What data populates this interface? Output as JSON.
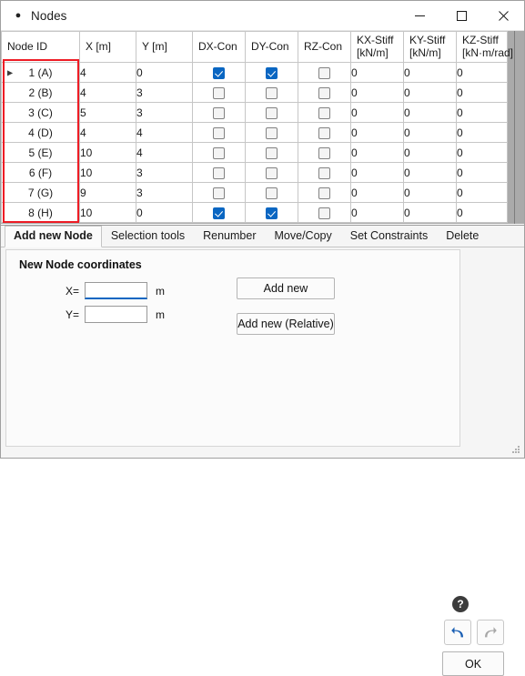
{
  "window": {
    "title": "Nodes",
    "icon": "dot-icon",
    "controls": {
      "minimize": "minimize-icon",
      "maximize": "maximize-icon",
      "close": "close-icon"
    }
  },
  "table": {
    "columns": [
      {
        "key": "node_id",
        "label": "Node ID",
        "unit": ""
      },
      {
        "key": "x",
        "label": "X [m]",
        "unit": ""
      },
      {
        "key": "y",
        "label": "Y [m]",
        "unit": ""
      },
      {
        "key": "dx_con",
        "label": "DX-Con",
        "unit": ""
      },
      {
        "key": "dy_con",
        "label": "DY-Con",
        "unit": ""
      },
      {
        "key": "rz_con",
        "label": "RZ-Con",
        "unit": ""
      },
      {
        "key": "kx_stiff",
        "label": "KX-Stiff",
        "unit": "[kN/m]"
      },
      {
        "key": "ky_stiff",
        "label": "KY-Stiff",
        "unit": "[kN/m]"
      },
      {
        "key": "kz_stiff",
        "label": "KZ-Stiff",
        "unit": "[kN·m/rad]"
      }
    ],
    "rows": [
      {
        "node_id": "1 (A)",
        "x": "4",
        "y": "0",
        "dx_con": true,
        "dy_con": true,
        "rz_con": false,
        "kx_stiff": "0",
        "ky_stiff": "0",
        "kz_stiff": "0",
        "selected": true,
        "current": true
      },
      {
        "node_id": "2 (B)",
        "x": "4",
        "y": "3",
        "dx_con": false,
        "dy_con": false,
        "rz_con": false,
        "kx_stiff": "0",
        "ky_stiff": "0",
        "kz_stiff": "0",
        "selected": false,
        "current": false
      },
      {
        "node_id": "3 (C)",
        "x": "5",
        "y": "3",
        "dx_con": false,
        "dy_con": false,
        "rz_con": false,
        "kx_stiff": "0",
        "ky_stiff": "0",
        "kz_stiff": "0",
        "selected": false,
        "current": false
      },
      {
        "node_id": "4 (D)",
        "x": "4",
        "y": "4",
        "dx_con": false,
        "dy_con": false,
        "rz_con": false,
        "kx_stiff": "0",
        "ky_stiff": "0",
        "kz_stiff": "0",
        "selected": false,
        "current": false
      },
      {
        "node_id": "5 (E)",
        "x": "10",
        "y": "4",
        "dx_con": false,
        "dy_con": false,
        "rz_con": false,
        "kx_stiff": "0",
        "ky_stiff": "0",
        "kz_stiff": "0",
        "selected": false,
        "current": false
      },
      {
        "node_id": "6 (F)",
        "x": "10",
        "y": "3",
        "dx_con": false,
        "dy_con": false,
        "rz_con": false,
        "kx_stiff": "0",
        "ky_stiff": "0",
        "kz_stiff": "0",
        "selected": false,
        "current": false
      },
      {
        "node_id": "7 (G)",
        "x": "9",
        "y": "3",
        "dx_con": false,
        "dy_con": false,
        "rz_con": false,
        "kx_stiff": "0",
        "ky_stiff": "0",
        "kz_stiff": "0",
        "selected": false,
        "current": false
      },
      {
        "node_id": "8 (H)",
        "x": "10",
        "y": "0",
        "dx_con": true,
        "dy_con": true,
        "rz_con": false,
        "kx_stiff": "0",
        "ky_stiff": "0",
        "kz_stiff": "0",
        "selected": false,
        "current": false
      }
    ],
    "row_marker_icon": "triangle-right-icon",
    "highlight": {
      "color": "#ee1c25",
      "target": "node-id-column"
    }
  },
  "tabs": [
    {
      "label": "Add new Node",
      "active": true
    },
    {
      "label": "Selection tools",
      "active": false
    },
    {
      "label": "Renumber",
      "active": false
    },
    {
      "label": "Move/Copy",
      "active": false
    },
    {
      "label": "Set Constraints",
      "active": false
    },
    {
      "label": "Delete",
      "active": false
    }
  ],
  "panel": {
    "title": "New Node coordinates",
    "x_label": "X=",
    "y_label": "Y=",
    "x_value": "",
    "y_value": "",
    "x_unit": "m",
    "y_unit": "m",
    "add_new_label": "Add new",
    "add_new_relative_label": "Add new (Relative)"
  },
  "actions": {
    "help_label": "?",
    "help_icon": "question-circle-icon",
    "undo_icon": "undo-arrow-icon",
    "redo_icon": "redo-arrow-icon",
    "ok_label": "OK"
  },
  "colors": {
    "selection_blue": "#0d7ac8",
    "checkbox_blue": "#0a66c2",
    "highlight_red": "#ee1c25",
    "panel_gray": "#aaaaaa"
  }
}
